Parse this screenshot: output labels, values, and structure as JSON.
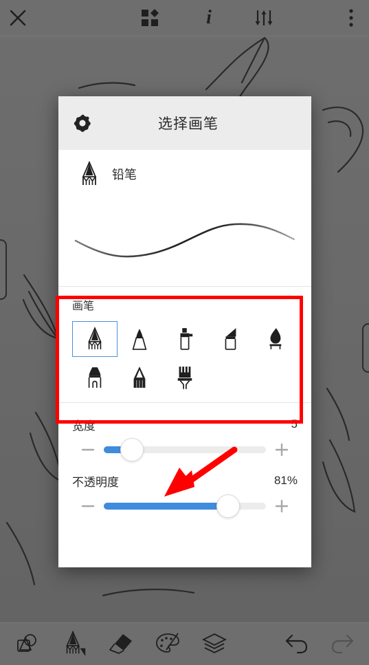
{
  "app": {
    "canvas_background": "#6a6a6a",
    "accent_color": "#3f8bde",
    "annotation_color": "#fe0000",
    "selected_outline_color": "#4a90d9"
  },
  "top_toolbar": {
    "items": [
      {
        "name": "close-icon",
        "label": "✕",
        "position": "left"
      },
      {
        "name": "shapes-grid-icon",
        "label": "",
        "position": "center"
      },
      {
        "name": "info-icon",
        "label": "i",
        "position": "center"
      },
      {
        "name": "adjustments-icon",
        "label": "",
        "position": "center"
      },
      {
        "name": "overflow-menu-icon",
        "label": "⋮",
        "position": "right"
      }
    ]
  },
  "dialog": {
    "title": "选择画笔",
    "settings_icon": "gear-icon",
    "current_brush": {
      "icon": "pencil-icon",
      "name": "铅笔"
    },
    "preview": {
      "name": "stroke-preview",
      "description": "S-curve pencil stroke"
    },
    "brush_section": {
      "label": "画笔",
      "brushes": [
        {
          "id": "pencil",
          "icon": "pencil-icon",
          "selected": true
        },
        {
          "id": "felt-tip",
          "icon": "felt-tip-pen-icon",
          "selected": false
        },
        {
          "id": "airbrush",
          "icon": "airbrush-icon",
          "selected": false
        },
        {
          "id": "chisel-marker",
          "icon": "chisel-marker-icon",
          "selected": false
        },
        {
          "id": "ink-brush",
          "icon": "ink-brush-icon",
          "selected": false
        },
        {
          "id": "marker",
          "icon": "marker-icon",
          "selected": false
        },
        {
          "id": "soft-pencil",
          "icon": "soft-pencil-icon",
          "selected": false
        },
        {
          "id": "paint-brush",
          "icon": "paint-brush-icon",
          "selected": false
        }
      ]
    },
    "sliders": [
      {
        "id": "width",
        "label": "宽度",
        "value_text": "5",
        "fill_percent": 12,
        "minus_icon": "minus-icon",
        "plus_icon": "plus-icon"
      },
      {
        "id": "opacity",
        "label": "不透明度",
        "value_text": "81%",
        "fill_percent": 81,
        "minus_icon": "minus-icon",
        "plus_icon": "plus-icon"
      }
    ]
  },
  "annotations": [
    {
      "type": "rectangle",
      "name": "brush-grid-highlight",
      "color": "#fe0000"
    },
    {
      "type": "arrow",
      "name": "width-slider-pointer",
      "color": "#fe0000"
    }
  ],
  "bottom_toolbar": {
    "items": [
      {
        "name": "transform-shapes-icon",
        "active": false,
        "dimmed": false
      },
      {
        "name": "brush-tool-icon",
        "active": true,
        "dimmed": false
      },
      {
        "name": "eraser-tool-icon",
        "active": false,
        "dimmed": false
      },
      {
        "name": "color-palette-icon",
        "active": false,
        "dimmed": false
      },
      {
        "name": "layers-icon",
        "active": false,
        "dimmed": false
      },
      {
        "name": "undo-icon",
        "active": false,
        "dimmed": false
      },
      {
        "name": "redo-icon",
        "active": false,
        "dimmed": true
      }
    ]
  }
}
